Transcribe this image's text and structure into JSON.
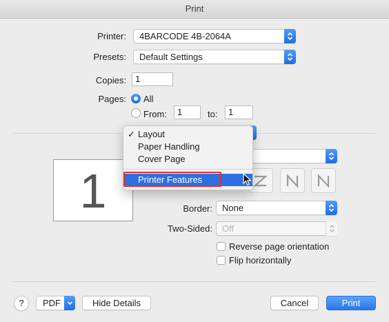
{
  "window": {
    "title": "Print"
  },
  "printer": {
    "label": "Printer:",
    "value": "4BARCODE 4B-2064A"
  },
  "presets": {
    "label": "Presets:",
    "value": "Default Settings"
  },
  "copies": {
    "label": "Copies:",
    "value": "1"
  },
  "pages": {
    "label": "Pages:",
    "all_label": "All",
    "from_label": "From:",
    "from_value": "1",
    "to_label": "to:",
    "to_value": "1"
  },
  "menu": {
    "items": [
      {
        "label": "Layout",
        "checked": true
      },
      {
        "label": "Paper Handling",
        "checked": false
      },
      {
        "label": "Cover Page",
        "checked": false
      },
      {
        "label": "Printer Features",
        "checked": false,
        "highlighted": true
      }
    ],
    "check_glyph": "✓"
  },
  "preview": {
    "page_number": "1"
  },
  "border": {
    "label": "Border:",
    "value": "None"
  },
  "two_sided": {
    "label": "Two-Sided:",
    "value": "Off"
  },
  "reverse": {
    "label": "Reverse page orientation"
  },
  "flip": {
    "label": "Flip horizontally"
  },
  "footer": {
    "help_label": "?",
    "pdf_label": "PDF",
    "hide_details_label": "Hide Details",
    "cancel_label": "Cancel",
    "print_label": "Print"
  },
  "colors": {
    "accent": "#2f6fe0",
    "highlight_outline": "#e03030"
  }
}
